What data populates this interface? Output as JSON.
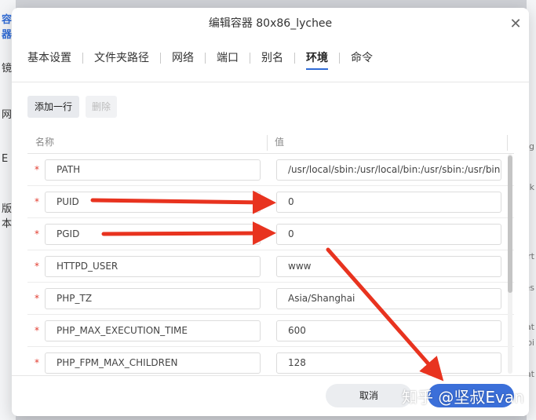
{
  "background": {
    "left_fragments": [
      "容器",
      "镜",
      "网",
      "E",
      "版本"
    ],
    "right_fragments": [
      "g",
      "k",
      "rt",
      "es",
      "at",
      "pi",
      "at"
    ]
  },
  "dialog": {
    "title": "编辑容器 80x86_lychee",
    "close_icon": "close-icon"
  },
  "tabs": [
    {
      "label": "基本设置",
      "active": false
    },
    {
      "label": "文件夹路径",
      "active": false
    },
    {
      "label": "网络",
      "active": false
    },
    {
      "label": "端口",
      "active": false
    },
    {
      "label": "别名",
      "active": false
    },
    {
      "label": "环境",
      "active": true
    },
    {
      "label": "命令",
      "active": false
    }
  ],
  "toolbar": {
    "add_label": "添加一行",
    "delete_label": "删除"
  },
  "table": {
    "headers": {
      "name": "名称",
      "value": "值"
    },
    "required_mark": "*",
    "rows": [
      {
        "name": "PATH",
        "value": "/usr/local/sbin:/usr/local/bin:/usr/sbin:/usr/bin"
      },
      {
        "name": "PUID",
        "value": "0"
      },
      {
        "name": "PGID",
        "value": "0"
      },
      {
        "name": "HTTPD_USER",
        "value": "www"
      },
      {
        "name": "PHP_TZ",
        "value": "Asia/Shanghai"
      },
      {
        "name": "PHP_MAX_EXECUTION_TIME",
        "value": "600"
      },
      {
        "name": "PHP_FPM_MAX_CHILDREN",
        "value": "128"
      }
    ]
  },
  "footer": {
    "cancel_label": "取消"
  },
  "watermark": "知乎 @坚叔Evan",
  "colors": {
    "accent": "#3b6fd9",
    "annotation_arrow": "#e8331f",
    "required": "#e23c2f"
  }
}
